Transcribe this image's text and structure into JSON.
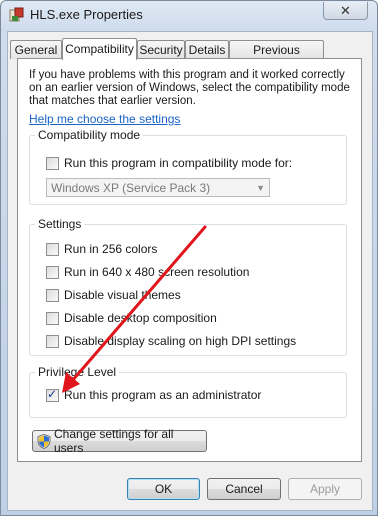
{
  "window": {
    "title": "HLS.exe Properties",
    "close_glyph": "✕"
  },
  "tabs": [
    {
      "label": "General",
      "active": false
    },
    {
      "label": "Compatibility",
      "active": true
    },
    {
      "label": "Security",
      "active": false
    },
    {
      "label": "Details",
      "active": false
    },
    {
      "label": "Previous Versions",
      "active": false
    }
  ],
  "compatibility": {
    "intro_text": "If you have problems with this program and it worked correctly on an earlier version of Windows, select the compatibility mode that matches that earlier version.",
    "help_link": "Help me choose the settings",
    "mode_group": {
      "label": "Compatibility mode",
      "checkbox_label": "Run this program in compatibility mode for:",
      "checked": false,
      "select_value": "Windows XP (Service Pack 3)"
    },
    "settings_group": {
      "label": "Settings",
      "items": [
        {
          "label": "Run in 256 colors",
          "checked": false
        },
        {
          "label": "Run in 640 x 480 screen resolution",
          "checked": false
        },
        {
          "label": "Disable visual themes",
          "checked": false
        },
        {
          "label": "Disable desktop composition",
          "checked": false
        },
        {
          "label": "Disable display scaling on high DPI settings",
          "checked": false
        }
      ]
    },
    "privilege_group": {
      "label": "Privilege Level",
      "checkbox_label": "Run this program as an administrator",
      "checked": true
    },
    "all_users_button": "Change settings for all users"
  },
  "footer": {
    "ok": "OK",
    "cancel": "Cancel",
    "apply": "Apply"
  },
  "annotation": {
    "arrow_color": "#e0161c"
  }
}
